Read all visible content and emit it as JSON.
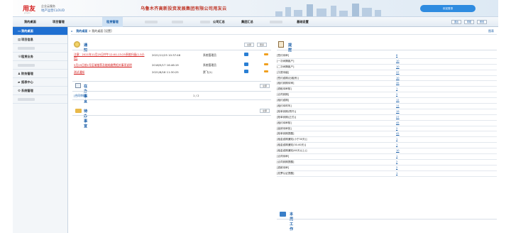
{
  "header": {
    "logo": "用友",
    "logo_sub": "yonyou",
    "brand_line1": "企业云服务",
    "brand_line2": "地产运营CLOUD",
    "company": "乌鲁木齐高新投资发展集团有限公司用友云",
    "user_button": "欢迎登录"
  },
  "nav": {
    "items": [
      "我的桌面",
      "项目管理",
      "租赁管理",
      "",
      "",
      "",
      "",
      "",
      "",
      "",
      "公司汇总",
      "集团汇总",
      "",
      "基础设置"
    ],
    "tools": [
      "退出",
      "帮助",
      "修改"
    ]
  },
  "sidebar": {
    "items": [
      {
        "label": "我的桌面",
        "icon": "desktop-icon"
      },
      {
        "label": "项目信息",
        "icon": "document-icon"
      },
      {
        "label": "",
        "icon": ""
      },
      {
        "label": "租赁业务",
        "icon": "phone-icon"
      },
      {
        "label": "",
        "icon": ""
      },
      {
        "label": "财务管理",
        "icon": "person-icon"
      },
      {
        "label": "报表中心",
        "icon": "folder-icon"
      },
      {
        "label": "系统管理",
        "icon": "gear-icon"
      },
      {
        "label": "",
        "icon": ""
      }
    ]
  },
  "breadcrumb": {
    "home": "我的桌面",
    "sep": ">",
    "path": "我的桌面 [设置]",
    "right_link": "图表"
  },
  "notice": {
    "title": "通    知",
    "buttons": [
      "全部",
      "更多"
    ],
    "rows": [
      {
        "title": "注意：2021年11月25日中午12:00-13:25系统升级(1.5小时)",
        "time": "2021/11/25 10:37:46",
        "dept": "系统管理员"
      },
      {
        "title": "5月25日前1号区域推荐及能耗缴费相关事项说明",
        "time": "2018/5/17 16:46:19",
        "dept": "系统管理员"
      },
      {
        "title": "测试通知",
        "time": "2021/8/18 11:30:25",
        "dept": "贾飞(1)"
      }
    ]
  },
  "todo": {
    "title": "在办事宜",
    "button": "全部",
    "rows": [
      {
        "name": "[合同审核]",
        "value": "1 / 2"
      }
    ]
  },
  "pending": {
    "title": "待办事宜",
    "button": "全部"
  },
  "reminder": {
    "title": "提    醒",
    "rows": [
      {
        "label": "[签约待审]",
        "value": "6"
      },
      {
        "label": "[一次间隔客户]",
        "value": "10"
      },
      {
        "label": "[二次间隔客户]",
        "value": "10"
      },
      {
        "label": "[欠费待催]",
        "value": "37"
      },
      {
        "label": "[签约逾期(出租房)]",
        "value": "10"
      },
      {
        "label": "[租约到期待审]",
        "value": "35"
      },
      {
        "label": "[退租待审核]",
        "value": "1"
      },
      {
        "label": "[合同到期]",
        "value": "2"
      },
      {
        "label": "[租约逾期]",
        "value": "12"
      },
      {
        "label": "[租约待呼叫]",
        "value": "11"
      },
      {
        "label": "[账单到期(预开)]",
        "value": "19"
      },
      {
        "label": "[账单到期(正式)]",
        "value": "27"
      },
      {
        "label": "[租约待审核]",
        "value": "45"
      },
      {
        "label": "[装修待审批]",
        "value": "2"
      },
      {
        "label": "[账单到期提醒]",
        "value": "42"
      },
      {
        "label": "[租金逾期通知(小于30天)]",
        "value": "1"
      },
      {
        "label": "[租金逾期通知(30-60天)]",
        "value": "1"
      },
      {
        "label": "[租金逾期通知(60天以上)]",
        "value": "10"
      },
      {
        "label": "[合同待审]",
        "value": "1"
      },
      {
        "label": "[合同到期提醒]",
        "value": "2"
      },
      {
        "label": "[退款待审]",
        "value": "2"
      },
      {
        "label": "[发票认证提醒]",
        "value": "1"
      }
    ]
  },
  "weekly": {
    "title": "本周工作"
  }
}
